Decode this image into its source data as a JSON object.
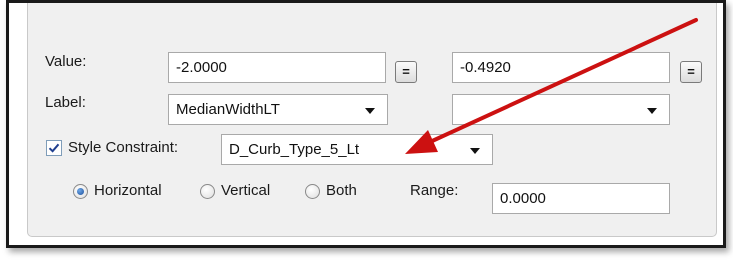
{
  "value_row": {
    "label": "Value:",
    "value1": "-2.0000",
    "value2": "-0.4920",
    "eq_button1": "=",
    "eq_button2": "="
  },
  "label_row": {
    "label": "Label:",
    "combo1_value": "MedianWidthLT",
    "combo2_value": ""
  },
  "style_row": {
    "checkbox_checked": true,
    "label": "Style Constraint:",
    "combo_value": "D_Curb_Type_5_Lt"
  },
  "orientation_row": {
    "options": [
      "Horizontal",
      "Vertical",
      "Both"
    ],
    "selected": "Horizontal",
    "range_label": "Range:",
    "range_value": "0.0000"
  },
  "annotation": {
    "arrow_color": "#cc1111"
  }
}
